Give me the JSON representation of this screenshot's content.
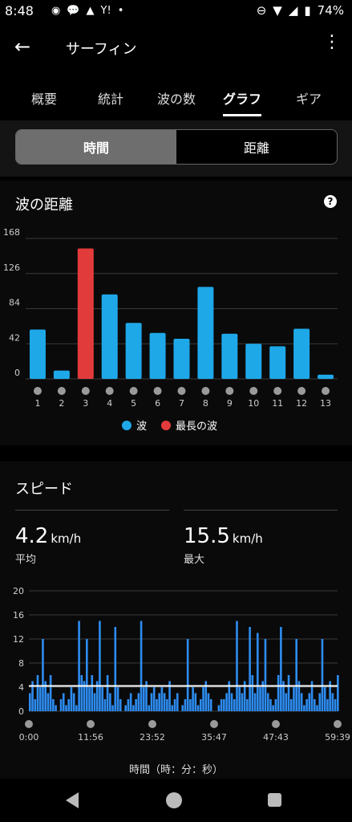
{
  "status": {
    "time": "8:48",
    "battery": "74%"
  },
  "appbar": {
    "title": "サーフィン"
  },
  "tabs": [
    {
      "label": "概要"
    },
    {
      "label": "統計"
    },
    {
      "label": "波の数"
    },
    {
      "label": "グラフ"
    },
    {
      "label": "ギア"
    }
  ],
  "segment": {
    "time": "時間",
    "distance": "距離"
  },
  "wave_card": {
    "title": "波の距離",
    "legend_wave": "波",
    "legend_longest": "最長の波"
  },
  "speed_card": {
    "title": "スピード",
    "avg_value": "4.2",
    "avg_unit": "km/h",
    "avg_label": "平均",
    "max_value": "15.5",
    "max_unit": "km/h",
    "max_label": "最大",
    "x_title": "時間（時：分：秒）"
  },
  "colors": {
    "wave": "#1ea8e8",
    "longest": "#e23b3b",
    "speed": "#2d8cf0"
  },
  "chart_data": [
    {
      "type": "bar",
      "categories": [
        "1",
        "2",
        "3",
        "4",
        "5",
        "6",
        "7",
        "8",
        "9",
        "10",
        "11",
        "12",
        "13"
      ],
      "values": [
        59,
        10,
        156,
        101,
        67,
        55,
        48,
        110,
        54,
        42,
        39,
        60,
        5
      ],
      "highlight_index": 2,
      "ylim": [
        0,
        168
      ],
      "yticks": [
        "0",
        "42",
        "84",
        "126",
        "168"
      ],
      "grid": true
    },
    {
      "type": "area",
      "xlabel": "時間（時：分：秒）",
      "ylim": [
        0,
        20
      ],
      "yticks": [
        "0",
        "4",
        "8",
        "12",
        "16",
        "20"
      ],
      "xticks": [
        "0:00",
        "11:56",
        "23:52",
        "35:47",
        "47:43",
        "59:39"
      ],
      "average_line": 4.2,
      "x_minutes": [
        0,
        0.5,
        1,
        1.5,
        2,
        2.5,
        3,
        3.5,
        4,
        4.5,
        5,
        5.5,
        6,
        6.5,
        7,
        7.5,
        8,
        8.5,
        9,
        9.5,
        10,
        10.5,
        11,
        11.5,
        12,
        12.5,
        13,
        13.5,
        14,
        14.5,
        15,
        15.5,
        16,
        16.5,
        17,
        17.5,
        18,
        18.5,
        19,
        19.5,
        20,
        20.5,
        21,
        21.5,
        22,
        22.5,
        23,
        23.5,
        24,
        24.5,
        25,
        25.5,
        26,
        26.5,
        27,
        27.5,
        28,
        28.5,
        29,
        29.5,
        30,
        30.5,
        31,
        31.5,
        32,
        32.5,
        33,
        33.5,
        34,
        34.5,
        35,
        35.5,
        36,
        36.5,
        37,
        37.5,
        38,
        38.5,
        39,
        39.5,
        40,
        40.5,
        41,
        41.5,
        42,
        42.5,
        43,
        43.5,
        44,
        44.5,
        45,
        45.5,
        46,
        46.5,
        47,
        47.5,
        48,
        48.5,
        49,
        49.5,
        50,
        50.5,
        51,
        51.5,
        52,
        52.5,
        53,
        53.5,
        54,
        54.5,
        55,
        55.5,
        56,
        56.5,
        57,
        57.5,
        58,
        58.5,
        59,
        59.5
      ],
      "y_speed": [
        3,
        5,
        2,
        6,
        4,
        12,
        5,
        3,
        6,
        2,
        1,
        0,
        2,
        3,
        1,
        2,
        4,
        3,
        1,
        15,
        6,
        5,
        12,
        4,
        6,
        3,
        5,
        15,
        4,
        2,
        6,
        3,
        1,
        14,
        4,
        2,
        0,
        1,
        2,
        3,
        1,
        2,
        3,
        15,
        4,
        5,
        1,
        3,
        4,
        2,
        3,
        4,
        3,
        2,
        5,
        1,
        2,
        3,
        0,
        1,
        2,
        12,
        2,
        4,
        3,
        1,
        2,
        4,
        5,
        3,
        2,
        0,
        0,
        1,
        2,
        2,
        3,
        5,
        3,
        2,
        15,
        4,
        3,
        5,
        2,
        14,
        6,
        3,
        13,
        4,
        5,
        12,
        3,
        2,
        1,
        2,
        6,
        14,
        5,
        3,
        6,
        2,
        4,
        12,
        5,
        3,
        1,
        2,
        3,
        5,
        2,
        1,
        3,
        12,
        4,
        2,
        5,
        3,
        2,
        6
      ]
    }
  ]
}
